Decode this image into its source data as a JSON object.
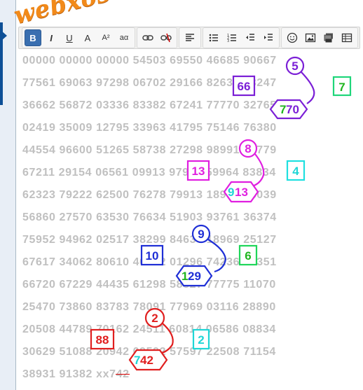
{
  "watermark": "webxoso.net",
  "toolbar": {
    "bold": "B",
    "italic": "I",
    "underline": "U",
    "text_color": "A",
    "font_size_up": "A²",
    "font_size_down": "aα",
    "link": "🔗",
    "unlink": "⛓",
    "align": "≡",
    "bullets": "•≡",
    "numbered": "1≡",
    "outdent": "⇤",
    "indent": "⇥",
    "emoji": "☺",
    "image": "▣",
    "media": "▦",
    "more": "▤"
  },
  "rows": [
    "00000 00000 00000 54503 69550 46685 90667",
    "77561 69063 97298 06702 29166 82632 03247",
    "36662 56872 03336 83382 67241 77770 32765",
    "02419 35009 12795 33963 41795 75146 76380",
    "44554 96600 51265 58738 27298 98991 81779",
    "67211 29154 06561 09913 97954 59964 83834",
    "62323 79222 62500 76278 79913 18932 88039",
    "56860 27570 63530 76634 51903 93761 36374",
    "75952 94962 02517 38299 84630 18969 25127",
    "67617 34062 80610 46982 01296 74236 36351",
    "66720 67229 44435 61298 58827 77775 11070",
    "25470 73860 83783 78091 77969 03116 28890",
    "20508 44789 70162 24511 60814 06586 08834",
    "30629 51088 20942 09592 57597 22508 71154",
    "38931 91382 xx742"
  ],
  "annotations": [
    {
      "group": "purple",
      "color": "#7b1fd6",
      "circle": "5",
      "square": "66",
      "hex": "770",
      "hex_lead": "7",
      "hex_lead_color": "#1fb51f",
      "box2": "7",
      "box2_color": "#1fd67a"
    },
    {
      "group": "magenta",
      "color": "#e01fe0",
      "circle": "8",
      "square": "13",
      "hex": "913",
      "hex_lead": "9",
      "hex_lead_color": "#1fd6d6",
      "box2": "4",
      "box2_color": "#1fe0e0"
    },
    {
      "group": "blue",
      "color": "#1f2fd6",
      "circle": "9",
      "square": "10",
      "hex": "129",
      "hex_lead": "1",
      "hex_lead_color": "#1fb51f",
      "box2": "6",
      "box2_color": "#1fd65a"
    },
    {
      "group": "red",
      "color": "#e01f1f",
      "circle": "2",
      "square": "88",
      "hex": "742",
      "hex_lead": "7",
      "hex_lead_color": "#1fd6d6",
      "box2": "2",
      "box2_color": "#1fd6d6"
    }
  ]
}
